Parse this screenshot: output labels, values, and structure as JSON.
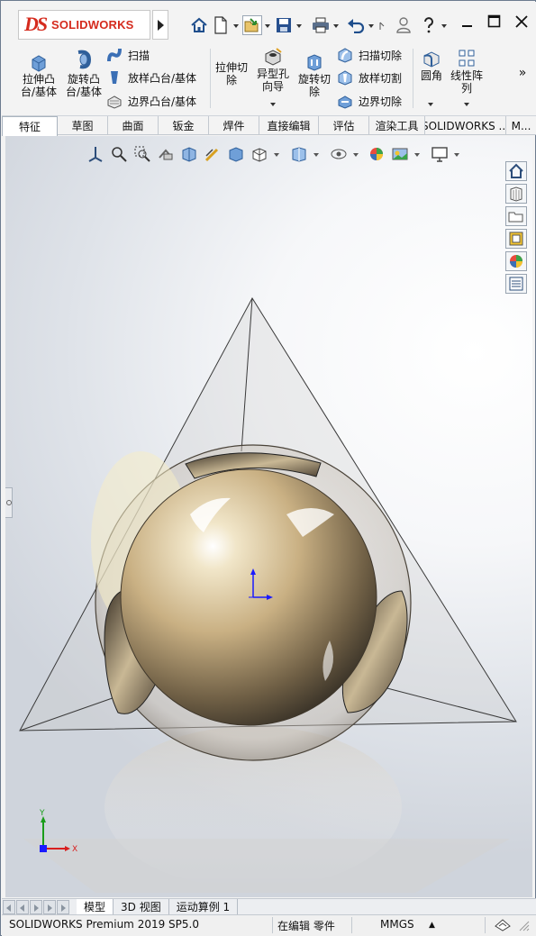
{
  "app": {
    "logo_ds": "DS",
    "logo_text": "SOLIDWORKS"
  },
  "ribbon": {
    "buttons": [
      {
        "label_line1": "拉伸凸",
        "label_line2": "台/基体",
        "icon": "extruded-boss-icon"
      },
      {
        "label_line1": "旋转凸",
        "label_line2": "台/基体",
        "icon": "revolved-boss-icon"
      },
      {
        "label_line1": "拉伸切",
        "label_line2": "除",
        "icon": "extruded-cut-icon"
      },
      {
        "label_line1": "异型孔",
        "label_line2": "向导",
        "icon": "hole-wizard-icon"
      },
      {
        "label_line1": "旋转切",
        "label_line2": "除",
        "icon": "revolved-cut-icon"
      },
      {
        "label_line1": "圆角",
        "label_line2": "",
        "icon": "fillet-icon"
      },
      {
        "label_line1": "线性阵",
        "label_line2": "列",
        "icon": "linear-pattern-icon"
      }
    ],
    "small": [
      {
        "label": "扫描",
        "icon": "swept-boss-icon"
      },
      {
        "label": "放样凸台/基体",
        "icon": "lofted-boss-icon"
      },
      {
        "label": "边界凸台/基体",
        "icon": "boundary-boss-icon"
      },
      {
        "label": "扫描切除",
        "icon": "swept-cut-icon"
      },
      {
        "label": "放样切割",
        "icon": "lofted-cut-icon"
      },
      {
        "label": "边界切除",
        "icon": "boundary-cut-icon"
      }
    ],
    "more": "»"
  },
  "tabs": [
    "特征",
    "草图",
    "曲面",
    "钣金",
    "焊件",
    "直接编辑",
    "评估",
    "渲染工具",
    "SOLIDWORKS ...",
    "M..."
  ],
  "axes": {
    "x": "X",
    "y": "Y"
  },
  "bottom_tabs": [
    "模型",
    "3D 视图",
    "运动算例 1"
  ],
  "status": {
    "product": "SOLIDWORKS Premium 2019 SP5.0",
    "editing": "在编辑 零件",
    "units": "MMGS",
    "units_arrow": "▲"
  },
  "colors": {
    "logo_red": "#d52b1e",
    "ribbon_bg": "#f3f3f3",
    "sphere_gold": "#b09a72",
    "axis_blue": "#1a1aff"
  }
}
